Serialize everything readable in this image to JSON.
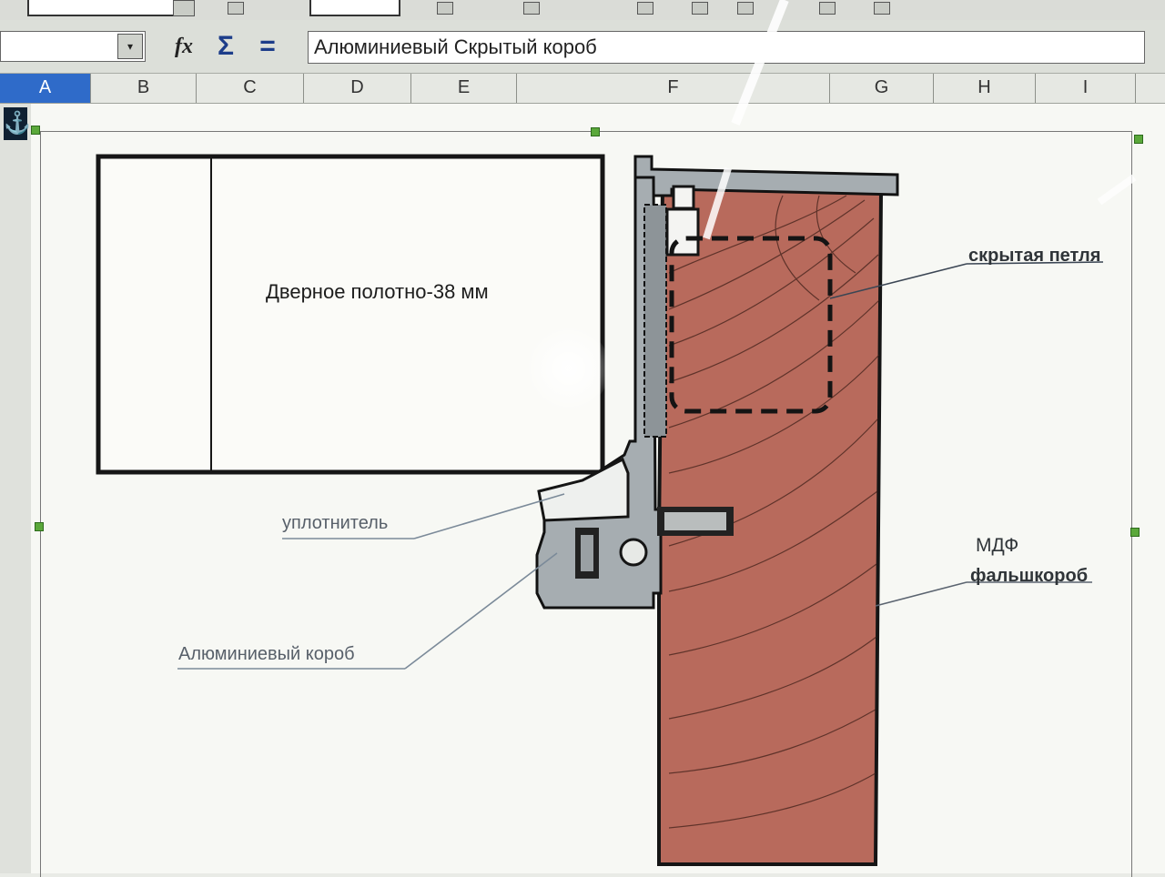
{
  "formula_bar": {
    "formula_text": "Алюминиевый Скрытый короб",
    "fx_label": "fx",
    "sum_label": "Σ",
    "equals_label": "="
  },
  "columns": [
    "A",
    "B",
    "C",
    "D",
    "E",
    "F",
    "G",
    "H",
    "I"
  ],
  "selected_column": "A",
  "drawing": {
    "door_label": "Дверное полотно-38 мм",
    "hinge_label": "скрытая петля",
    "seal_label": "уплотнитель",
    "mdf_label": "МДФ",
    "false_box_label": "фальшкороб",
    "alu_box_label": "Алюминиевый короб"
  },
  "colors": {
    "accent": "#2f6bc9",
    "mdf_fill": "#b86a5c",
    "aluminium_fill": "#a6adb1",
    "handle_green": "#5aa83a"
  }
}
